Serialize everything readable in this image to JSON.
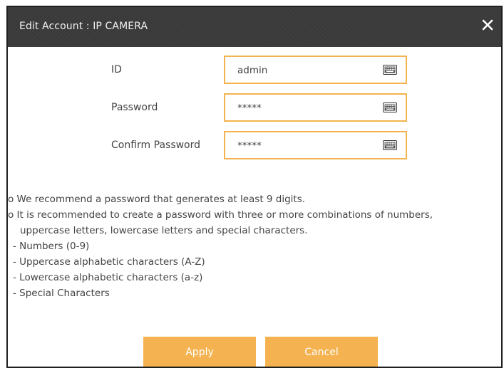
{
  "dialog": {
    "title": "Edit Account : IP CAMERA",
    "close_icon": "close-icon"
  },
  "form": {
    "fields": [
      {
        "label": "ID",
        "value": "admin",
        "icon": "keyboard-icon"
      },
      {
        "label": "Password",
        "value": "*****",
        "icon": "keyboard-icon"
      },
      {
        "label": "Confirm Password",
        "value": "*****",
        "icon": "keyboard-icon"
      }
    ]
  },
  "notes": {
    "line1": "o We recommend a password that generates at least 9 digits.",
    "line2": "o It is recommended to create a password with three or more combinations of numbers,",
    "line3": "uppercase letters, lowercase letters and special characters.",
    "items": [
      "- Numbers (0-9)",
      "- Uppercase alphabetic characters (A-Z)",
      "- Lowercase alphabetic characters (a-z)",
      "- Special Characters"
    ]
  },
  "buttons": {
    "apply": "Apply",
    "cancel": "Cancel"
  },
  "colors": {
    "accent": "#f4b350",
    "titlebar": "#3a3a3a",
    "border": "#1f1f1f",
    "text": "#444444"
  }
}
